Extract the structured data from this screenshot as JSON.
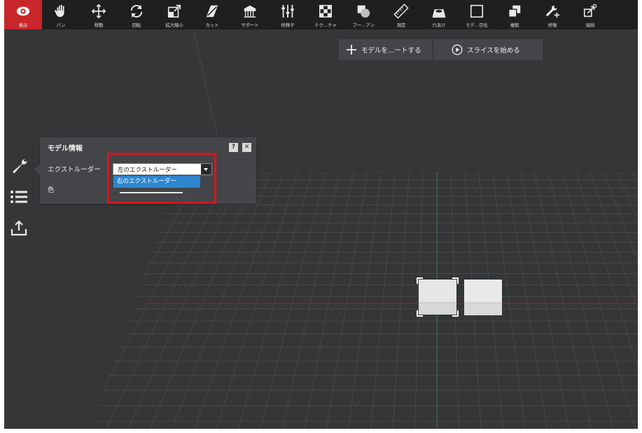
{
  "toolbar": {
    "tools": [
      {
        "label": "表示",
        "icon": "eye-icon",
        "active": true
      },
      {
        "label": "パン",
        "icon": "hand-icon"
      },
      {
        "label": "移動",
        "icon": "move-arrows-icon"
      },
      {
        "label": "回転",
        "icon": "rotate-icon"
      },
      {
        "label": "拡大縮小",
        "icon": "scale-icon"
      },
      {
        "label": "カット",
        "icon": "cut-icon"
      },
      {
        "label": "サポート",
        "icon": "support-icon"
      },
      {
        "label": "修飾子",
        "icon": "modifier-icon"
      },
      {
        "label": "テク…チャ",
        "icon": "texture-icon"
      },
      {
        "label": "ブー…アン",
        "icon": "boolean-icon"
      },
      {
        "label": "測定",
        "icon": "ruler-icon"
      },
      {
        "label": "穴あけ",
        "icon": "hole-icon"
      },
      {
        "label": "モデ…空化",
        "icon": "hollow-icon"
      },
      {
        "label": "複製",
        "icon": "duplicate-icon"
      },
      {
        "label": "修復",
        "icon": "repair-icon"
      },
      {
        "label": "接続",
        "icon": "connect-icon"
      }
    ]
  },
  "top_buttons": {
    "add_model": "モデルを…ートする",
    "start_slicing": "スライスを始める"
  },
  "panel": {
    "title": "モデル情報",
    "help": "?",
    "close": "✕",
    "extruder_label": "エクストルーダー",
    "extruder_selected": "左のエクストルーダー",
    "extruder_option_highlighted": "右のエクストルーダー",
    "color_label": "色"
  },
  "colors": {
    "accent": "#c8262a",
    "highlight_box": "#d5161e",
    "option_selected": "#2f86d0",
    "background": "#353638"
  }
}
